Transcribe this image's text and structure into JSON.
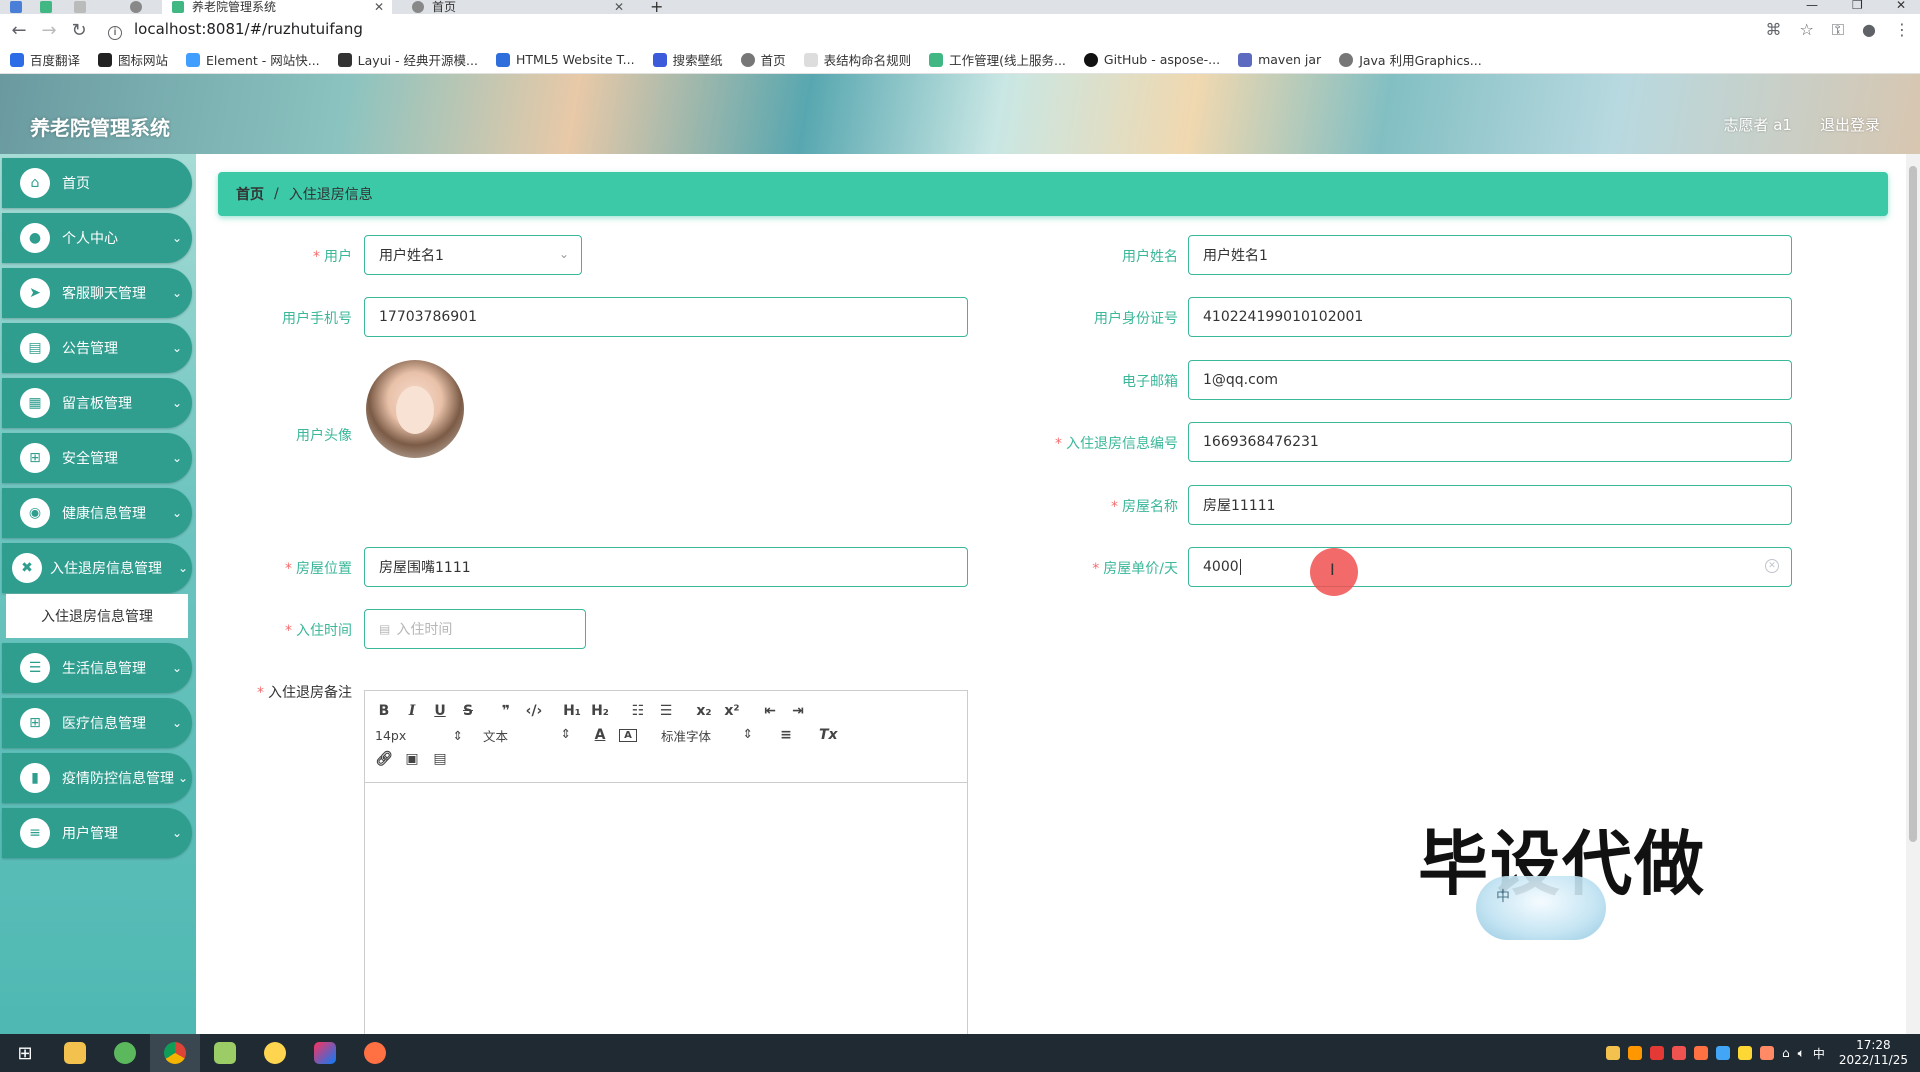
{
  "browser": {
    "tabs": [
      {
        "label": "养老院管理系统",
        "active": true
      },
      {
        "label": "首页",
        "active": false
      }
    ],
    "new_tab": "+",
    "url": "localhost:8081/#/ruzhutuifang",
    "bookmarks": [
      "百度翻译",
      "图标网站",
      "Element - 网站快...",
      "Layui - 经典开源模...",
      "HTML5 Website T...",
      "搜索壁纸",
      "首页",
      "表结构命名规则",
      "工作管理(线上服务...",
      "GitHub - aspose-...",
      "maven jar",
      "Java 利用Graphics..."
    ]
  },
  "header": {
    "title": "养老院管理系统",
    "user": "志愿者 a1",
    "logout": "退出登录"
  },
  "sidebar": {
    "items": [
      {
        "label": "首页",
        "icon": "home-icon",
        "has_children": false
      },
      {
        "label": "个人中心",
        "icon": "person-icon",
        "has_children": true
      },
      {
        "label": "客服聊天管理",
        "icon": "send-icon",
        "has_children": true
      },
      {
        "label": "公告管理",
        "icon": "briefcase-icon",
        "has_children": true
      },
      {
        "label": "留言板管理",
        "icon": "document-icon",
        "has_children": true
      },
      {
        "label": "安全管理",
        "icon": "grid-icon",
        "has_children": true
      },
      {
        "label": "健康信息管理",
        "icon": "location-icon",
        "has_children": true
      },
      {
        "label": "入住退房信息管理",
        "icon": "bed-icon",
        "has_children": true
      },
      {
        "label": "生活信息管理",
        "icon": "list-icon",
        "has_children": true
      },
      {
        "label": "医疗信息管理",
        "icon": "grid-icon",
        "has_children": true
      },
      {
        "label": "疫情防控信息管理",
        "icon": "book-icon",
        "has_children": true
      },
      {
        "label": "用户管理",
        "icon": "menu-icon",
        "has_children": true
      }
    ],
    "active_sub": "入住退房信息管理"
  },
  "breadcrumb": {
    "home": "首页",
    "separator": "/",
    "current": "入住退房信息"
  },
  "form": {
    "user": {
      "label": "用户",
      "value": "用户姓名1",
      "required": "*"
    },
    "user_name": {
      "label": "用户姓名",
      "value": "用户姓名1"
    },
    "phone": {
      "label": "用户手机号",
      "value": "17703786901"
    },
    "id_card": {
      "label": "用户身份证号",
      "value": "410224199010102001"
    },
    "avatar": {
      "label": "用户头像"
    },
    "email": {
      "label": "电子邮箱",
      "value": "1@qq.com"
    },
    "record_no": {
      "label": "入住退房信息编号",
      "value": "1669368476231",
      "required": "*"
    },
    "room_name": {
      "label": "房屋名称",
      "value": "房屋11111",
      "required": "*"
    },
    "room_location": {
      "label": "房屋位置",
      "value": "房屋围嘴1111",
      "required": "*"
    },
    "room_price": {
      "label": "房屋单价/天",
      "value": "4000",
      "required": "*"
    },
    "checkin_time": {
      "label": "入住时间",
      "placeholder": "入住时间",
      "required": "*"
    },
    "remark": {
      "label": "入住退房备注",
      "required": "*"
    }
  },
  "editor": {
    "font_size": "14px",
    "heading": "文本",
    "font_family": "标准字体"
  },
  "watermark": {
    "text": "毕设代做",
    "badge": "中"
  },
  "taskbar": {
    "time": "17:28",
    "date": "2022/11/25",
    "ime": "中"
  },
  "colors": {
    "accent": "#3bb79a",
    "sidebar_item": "#2f9e8f",
    "breadcrumb": "#3cc9a8",
    "required": "#f56c6c"
  }
}
